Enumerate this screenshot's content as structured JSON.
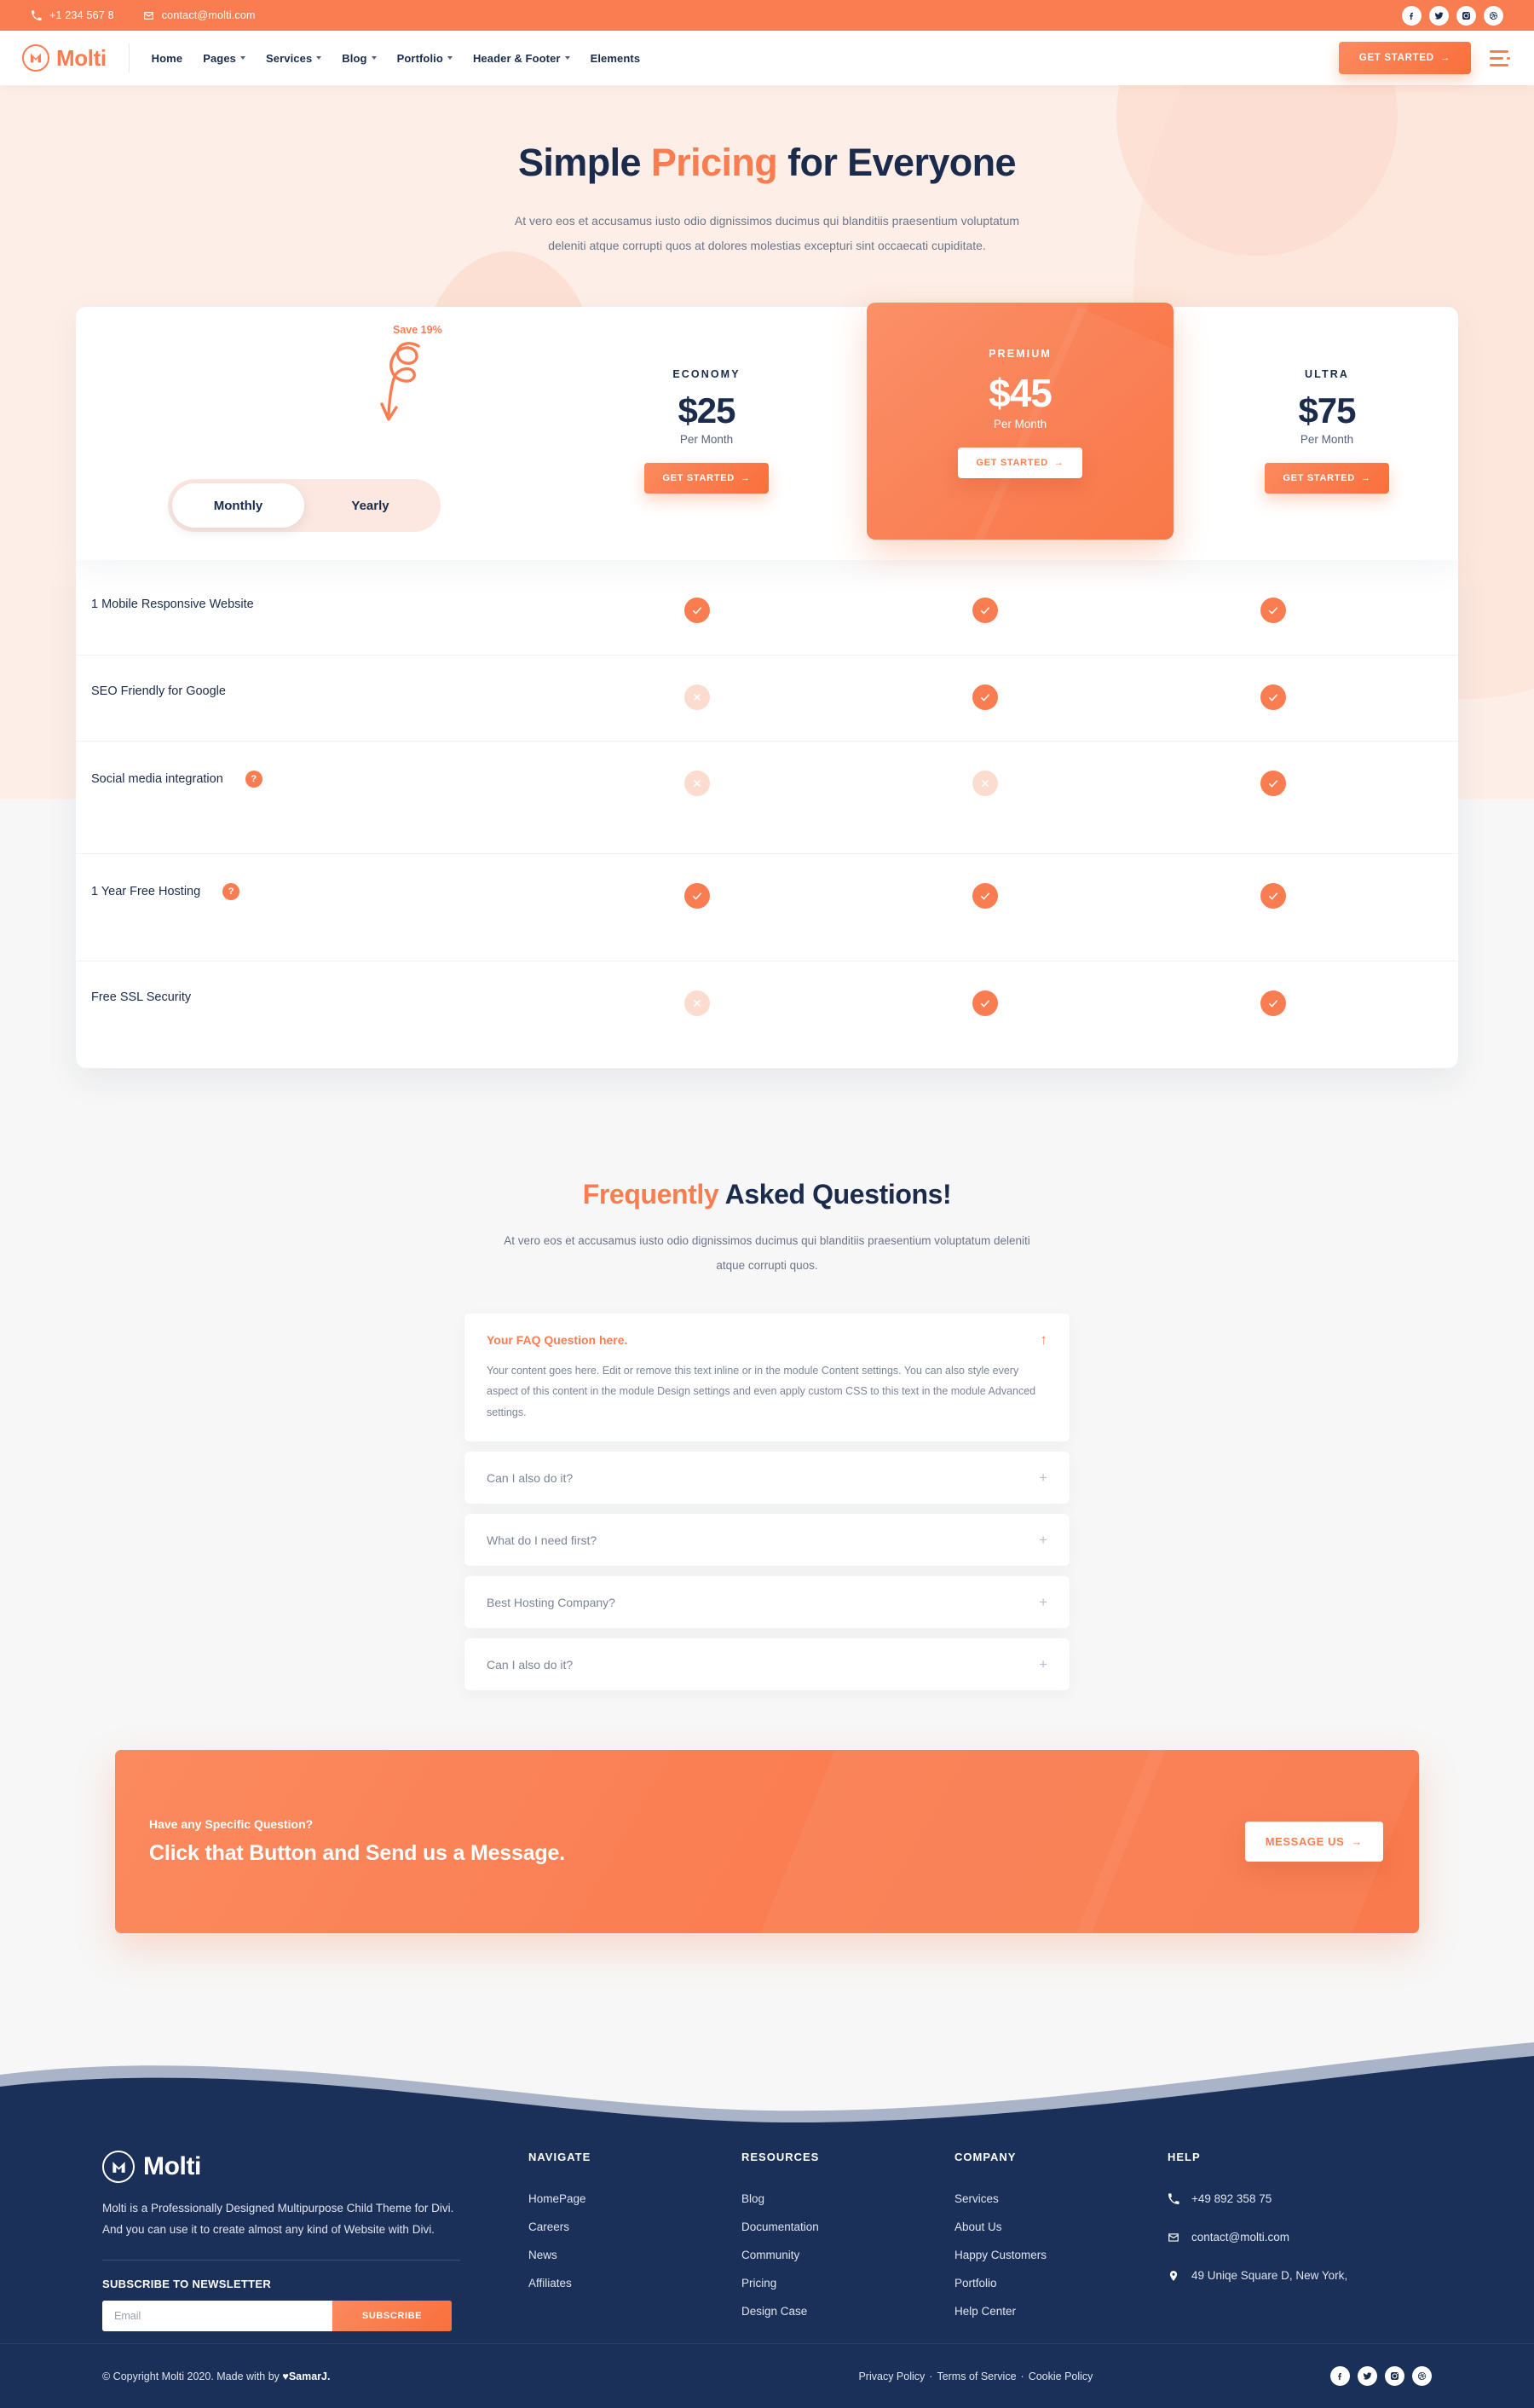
{
  "topbar": {
    "phone": "+1 234 567 8",
    "email": "contact@molti.com",
    "phone_icon": "phone-icon",
    "email_icon": "envelope-icon",
    "socials": [
      "facebook-icon",
      "twitter-icon",
      "instagram-icon",
      "dribbble-icon"
    ]
  },
  "header": {
    "brand": "Molti",
    "nav": [
      {
        "label": "Home",
        "caret": false
      },
      {
        "label": "Pages",
        "caret": true
      },
      {
        "label": "Services",
        "caret": true
      },
      {
        "label": "Blog",
        "caret": true
      },
      {
        "label": "Portfolio",
        "caret": true
      },
      {
        "label": "Header & Footer",
        "caret": true
      },
      {
        "label": "Elements",
        "caret": false
      }
    ],
    "cta_label": "GET STARTED",
    "cta_arrow": "→"
  },
  "hero": {
    "title_pre": "Simple ",
    "title_hl": "Pricing",
    "title_post": " for Everyone",
    "subtitle": "At vero eos et accusamus iusto odio dignissimos ducimus qui blanditiis praesentium voluptatum deleniti atque corrupti quos at dolores molestias excepturi sint occaecati cupiditate."
  },
  "pricing": {
    "save_label": "Save 19%",
    "toggle": {
      "monthly": "Monthly",
      "yearly": "Yearly",
      "active": "Monthly"
    },
    "plans": [
      {
        "name": "ECONOMY",
        "price": "$25",
        "period": "Per Month",
        "button": "GET STARTED",
        "arrow": "→",
        "featured": false
      },
      {
        "name": "PREMIUM",
        "price": "$45",
        "period": "Per Month",
        "button": "GET STARTED",
        "arrow": "→",
        "featured": true
      },
      {
        "name": "ULTRA",
        "price": "$75",
        "period": "Per Month",
        "button": "GET STARTED",
        "arrow": "→",
        "featured": false
      }
    ],
    "features": [
      {
        "label": "1 Mobile Responsive Website",
        "help": false,
        "economy": "yes",
        "premium": "yes",
        "ultra": "yes"
      },
      {
        "label": "SEO Friendly for Google",
        "help": false,
        "economy": "no",
        "premium": "yes",
        "ultra": "yes"
      },
      {
        "label": "Social media integration",
        "help": true,
        "economy": "no",
        "premium": "no",
        "ultra": "yes"
      },
      {
        "label": "1 Year Free Hosting",
        "help": true,
        "economy": "yes",
        "premium": "yes",
        "ultra": "yes"
      },
      {
        "label": "Free SSL Security",
        "help": false,
        "economy": "no",
        "premium": "yes",
        "ultra": "yes"
      }
    ],
    "help_glyph": "?"
  },
  "faq": {
    "title_hl": "Frequently",
    "title_rest": " Asked Questions!",
    "subtitle": "At vero eos et accusamus iusto odio dignissimos ducimus qui blanditiis praesentium voluptatum deleniti atque corrupti quos.",
    "items": [
      {
        "question": "Your FAQ Question here.",
        "answer": "Your content goes here. Edit or remove this text inline or in the module Content settings. You can also style every aspect of this content in the module Design settings and even apply custom CSS to this text in the module Advanced settings.",
        "open": true,
        "sign": "↑"
      },
      {
        "question": "Can I also do it?",
        "answer": "",
        "open": false,
        "sign": "+"
      },
      {
        "question": "What do I need first?",
        "answer": "",
        "open": false,
        "sign": "+"
      },
      {
        "question": "Best Hosting Company?",
        "answer": "",
        "open": false,
        "sign": "+"
      },
      {
        "question": "Can I also do it?",
        "answer": "",
        "open": false,
        "sign": "+"
      }
    ]
  },
  "cta": {
    "small": "Have any Specific Question?",
    "big": "Click that Button and Send us a Message.",
    "button": "MESSAGE US",
    "arrow": "→"
  },
  "footer": {
    "brand": "Molti",
    "about": "Molti is a Professionally Designed  Multipurpose Child Theme for Divi. And you can use it to create almost any kind of Website with Divi.",
    "newsletter_title": "SUBSCRIBE TO NEWSLETTER",
    "email_placeholder": "Email",
    "email_value": "",
    "subscribe_label": "SUBSCRIBE",
    "columns": [
      {
        "title": "NAVIGATE",
        "links": [
          "HomePage",
          "Careers",
          "News",
          "Affiliates"
        ]
      },
      {
        "title": "RESOURCES",
        "links": [
          "Blog",
          "Documentation",
          "Community",
          "Pricing",
          "Design Case"
        ]
      },
      {
        "title": "COMPANY",
        "links": [
          "Services",
          "About Us",
          "Happy Customers",
          "Portfolio",
          "Help Center"
        ]
      }
    ],
    "help_title": "HELP",
    "contacts": [
      {
        "icon": "phone-icon",
        "text": "+49 892 358 75"
      },
      {
        "icon": "envelope-icon",
        "text": "contact@molti.com"
      },
      {
        "icon": "map-pin-icon",
        "text": "49 Uniqe Square D, New York,"
      }
    ],
    "copyright_pre": "© Copyright Molti 2020. Made with by ",
    "copyright_heart": "♥",
    "copyright_author": "SamarJ.",
    "legal": [
      "Privacy Policy",
      "Terms of Service",
      "Cookie Policy"
    ],
    "legal_sep": "·",
    "socials": [
      "facebook-icon",
      "twitter-icon",
      "instagram-icon",
      "dribbble-icon"
    ]
  },
  "colors": {
    "accent": "#fa7d51",
    "accent_light": "#fbdccf",
    "hero_bg": "#fdeee7",
    "footer_bg": "#1b3058",
    "text_dark": "#1b2b4b"
  }
}
